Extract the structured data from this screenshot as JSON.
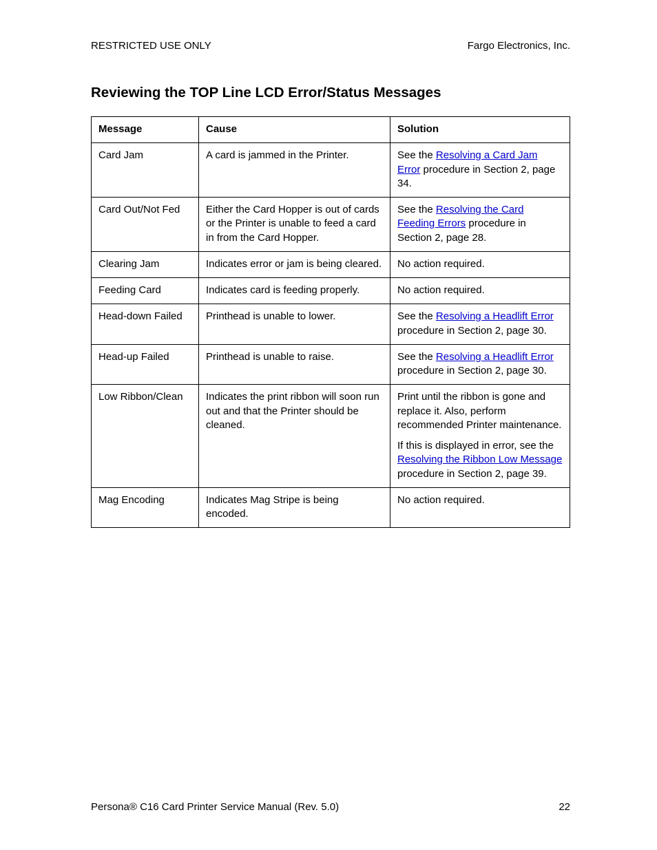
{
  "header": {
    "left": "RESTRICTED USE ONLY",
    "right": "Fargo Electronics, Inc."
  },
  "title": "Reviewing the TOP Line LCD Error/Status Messages",
  "tableHeaders": {
    "message": "Message",
    "cause": "Cause",
    "solution": "Solution"
  },
  "rows": [
    {
      "message": "Card Jam",
      "cause": "A card is jammed in the Printer.",
      "solution": {
        "pre": "See the ",
        "link": "Resolving a Card Jam Error",
        "post": " procedure in Section 2, page 34."
      }
    },
    {
      "message": "Card Out/Not Fed",
      "cause": "Either the Card Hopper is out of cards or the Printer is unable to feed a card in from the Card Hopper.",
      "solution": {
        "pre": "See the ",
        "link": "Resolving the Card Feeding Errors",
        "post": " procedure in Section 2, page 28."
      }
    },
    {
      "message": "Clearing Jam",
      "cause": "Indicates error or jam is being cleared.",
      "solution": {
        "pre": "No action required.",
        "link": "",
        "post": ""
      }
    },
    {
      "message": "Feeding Card",
      "cause": "Indicates card is feeding properly.",
      "solution": {
        "pre": "No action required.",
        "link": "",
        "post": ""
      }
    },
    {
      "message": "Head-down Failed",
      "cause": "Printhead is unable to lower.",
      "solution": {
        "pre": "See the ",
        "link": "Resolving a Headlift Error",
        "post": " procedure in Section 2, page 30."
      }
    },
    {
      "message": "Head-up Failed",
      "cause": "Printhead is unable to raise.",
      "solution": {
        "pre": "See the ",
        "link": "Resolving a Headlift Error",
        "post": " procedure in Section 2, page 30."
      }
    },
    {
      "message": "Low Ribbon/Clean",
      "cause": "Indicates the print ribbon will soon run out and that the Printer should be cleaned.",
      "solution": {
        "pre": "Print until the ribbon is gone and replace it. Also, perform recommended Printer maintenance.",
        "link": "",
        "post": ""
      },
      "solution2": {
        "pre": "If this is displayed in error, see the ",
        "link": "Resolving the Ribbon Low Message",
        "post": " procedure in Section 2, page 39."
      }
    },
    {
      "message": "Mag Encoding",
      "cause": "Indicates Mag Stripe is being encoded.",
      "solution": {
        "pre": "No action required.",
        "link": "",
        "post": ""
      }
    }
  ],
  "footer": {
    "left_pre": "Persona",
    "left_reg": "®",
    "left_post": " C16 Card Printer Service Manual (Rev. 5.0)",
    "page": "22"
  }
}
